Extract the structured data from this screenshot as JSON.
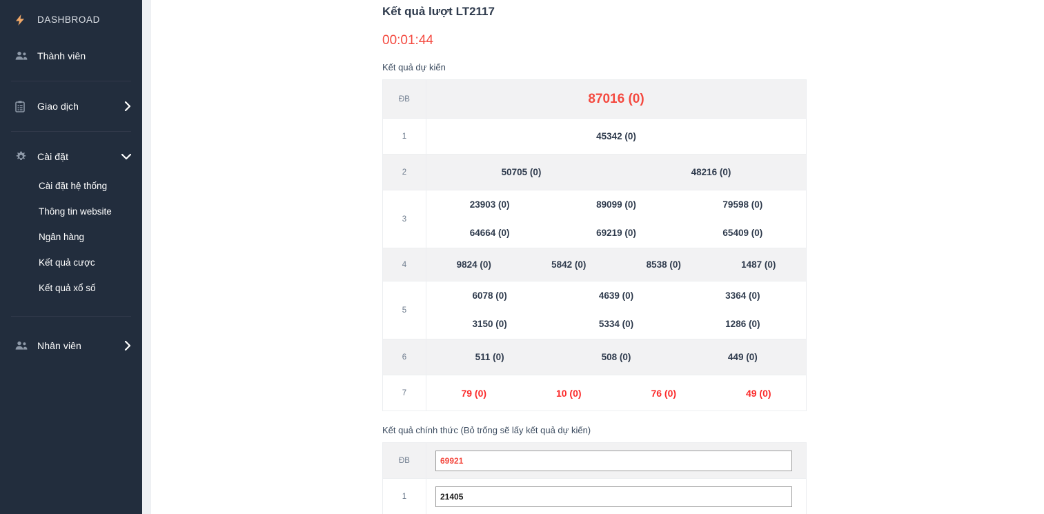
{
  "sidebar": {
    "brand": {
      "label": "DASHBROAD",
      "icon": "bolt-icon",
      "accent": "#f0a868"
    },
    "items": [
      {
        "label": "Thành viên",
        "icon": "people-icon",
        "caret": ""
      },
      {
        "label": "Giao dịch",
        "icon": "clipboard-icon",
        "caret": "chevron-right-icon"
      },
      {
        "label": "Cài đặt",
        "icon": "gear-icon",
        "caret": "chevron-down-icon"
      },
      {
        "label": "Nhân viên",
        "icon": "people-icon",
        "caret": "chevron-right-icon"
      }
    ],
    "settings_children": [
      {
        "label": "Cài đặt hệ thống"
      },
      {
        "label": "Thông tin website"
      },
      {
        "label": "Ngân hàng"
      },
      {
        "label": "Kết quả cược"
      },
      {
        "label": "Kết quả xổ số"
      }
    ],
    "background": "#222d3d"
  },
  "main": {
    "title": "Kết quả lượt LT2117",
    "countdown": "00:01:44",
    "countdown_color": "#f4493f",
    "predicted_label": "Kết quả dự kiến",
    "official_label": "Kết quả chính thức (Bỏ trống sẽ lấy kết quả dự kiến)"
  },
  "predicted_table": {
    "rows": [
      {
        "label": "ĐB",
        "lines": [
          [
            "87016 (0)"
          ]
        ],
        "style": "special",
        "shaded": true
      },
      {
        "label": "1",
        "lines": [
          [
            "45342 (0)"
          ]
        ],
        "style": "normal",
        "shaded": false
      },
      {
        "label": "2",
        "lines": [
          [
            "50705 (0)",
            "48216 (0)"
          ]
        ],
        "style": "normal",
        "shaded": true
      },
      {
        "label": "3",
        "lines": [
          [
            "23903 (0)",
            "89099 (0)",
            "79598 (0)"
          ],
          [
            "64664 (0)",
            "69219 (0)",
            "65409 (0)"
          ]
        ],
        "style": "normal",
        "shaded": false
      },
      {
        "label": "4",
        "lines": [
          [
            "9824 (0)",
            "5842 (0)",
            "8538 (0)",
            "1487 (0)"
          ]
        ],
        "style": "normal",
        "shaded": true
      },
      {
        "label": "5",
        "lines": [
          [
            "6078 (0)",
            "4639 (0)",
            "3364 (0)"
          ],
          [
            "3150 (0)",
            "5334 (0)",
            "1286 (0)"
          ]
        ],
        "style": "normal",
        "shaded": false
      },
      {
        "label": "6",
        "lines": [
          [
            "511 (0)",
            "508 (0)",
            "449 (0)"
          ]
        ],
        "style": "normal",
        "shaded": true
      },
      {
        "label": "7",
        "lines": [
          [
            "79 (0)",
            "10 (0)",
            "76 (0)",
            "49 (0)"
          ]
        ],
        "style": "red",
        "shaded": false
      }
    ]
  },
  "official_table": {
    "rows": [
      {
        "label": "ĐB",
        "value": "69921",
        "placeholder": "",
        "color": "red",
        "shaded": true
      },
      {
        "label": "1",
        "value": "21405",
        "placeholder": "",
        "color": "dark",
        "shaded": false
      }
    ]
  }
}
